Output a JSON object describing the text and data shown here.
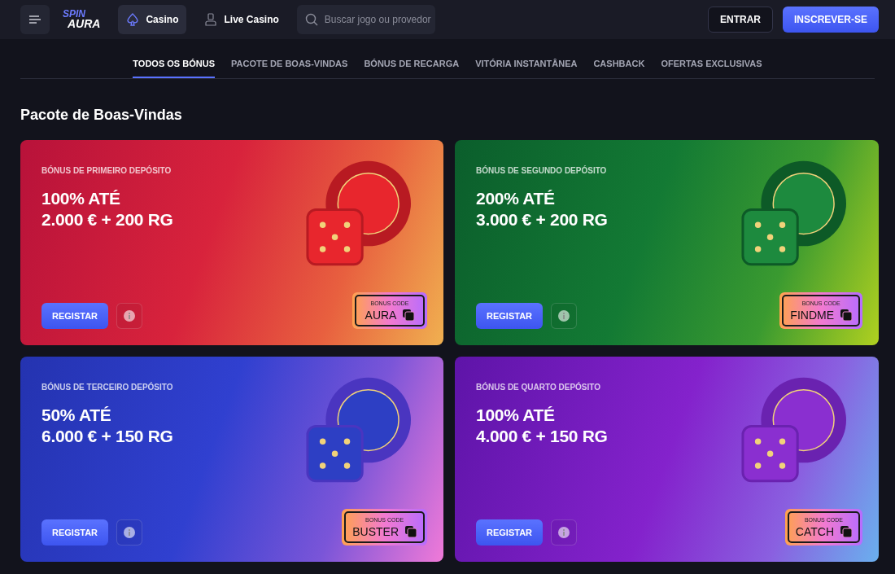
{
  "header": {
    "logo": {
      "top": "SPIN",
      "bottom": "AURA"
    },
    "nav": [
      {
        "label": "Casino",
        "kind": "spade",
        "selected": true
      },
      {
        "label": "Live Casino",
        "kind": "dealer",
        "selected": false
      }
    ],
    "search": {
      "placeholder": "Buscar jogo ou provedor"
    },
    "buttons": [
      {
        "label": "ENTRAR",
        "kind": "outline"
      },
      {
        "label": "INSCREVER-SE",
        "kind": "primary"
      }
    ]
  },
  "tabs": [
    {
      "label": "TODOS OS BÓNUS",
      "selected": true
    },
    {
      "label": "PACOTE DE BOAS-VINDAS",
      "selected": false
    },
    {
      "label": "BÓNUS DE RECARGA",
      "selected": false
    },
    {
      "label": "VITÓRIA INSTANTÂNEA",
      "selected": false
    },
    {
      "label": "CASHBACK",
      "selected": false
    },
    {
      "label": "OFERTAS EXCLUSIVAS",
      "selected": false
    }
  ],
  "section_title": "Pacote de Boas-Vindas",
  "cards": [
    {
      "eyebrow": "BÓNUS DE PRIMEIRO DEPÓSITO",
      "line1": "100% ATÉ",
      "line2": "2.000 € + 200 RG",
      "button": "REGISTAR",
      "code_label": "BONUS CODE",
      "code": "AURA"
    },
    {
      "eyebrow": "BÓNUS DE SEGUNDO DEPÓSITO",
      "line1": "200% ATÉ",
      "line2": "3.000 € + 200 RG",
      "button": "REGISTAR",
      "code_label": "BONUS CODE",
      "code": "FINDME"
    },
    {
      "eyebrow": "BÓNUS DE TERCEIRO DEPÓSITO",
      "line1": "50% ATÉ",
      "line2": "6.000 € + 150 RG",
      "button": "REGISTAR",
      "code_label": "BONUS CODE",
      "code": "BUSTER"
    },
    {
      "eyebrow": "BÓNUS DE QUARTO DEPÓSITO",
      "line1": "100% ATÉ",
      "line2": "4.000 € + 150 RG",
      "button": "REGISTAR",
      "code_label": "BONUS CODE",
      "code": "CATCH"
    }
  ]
}
